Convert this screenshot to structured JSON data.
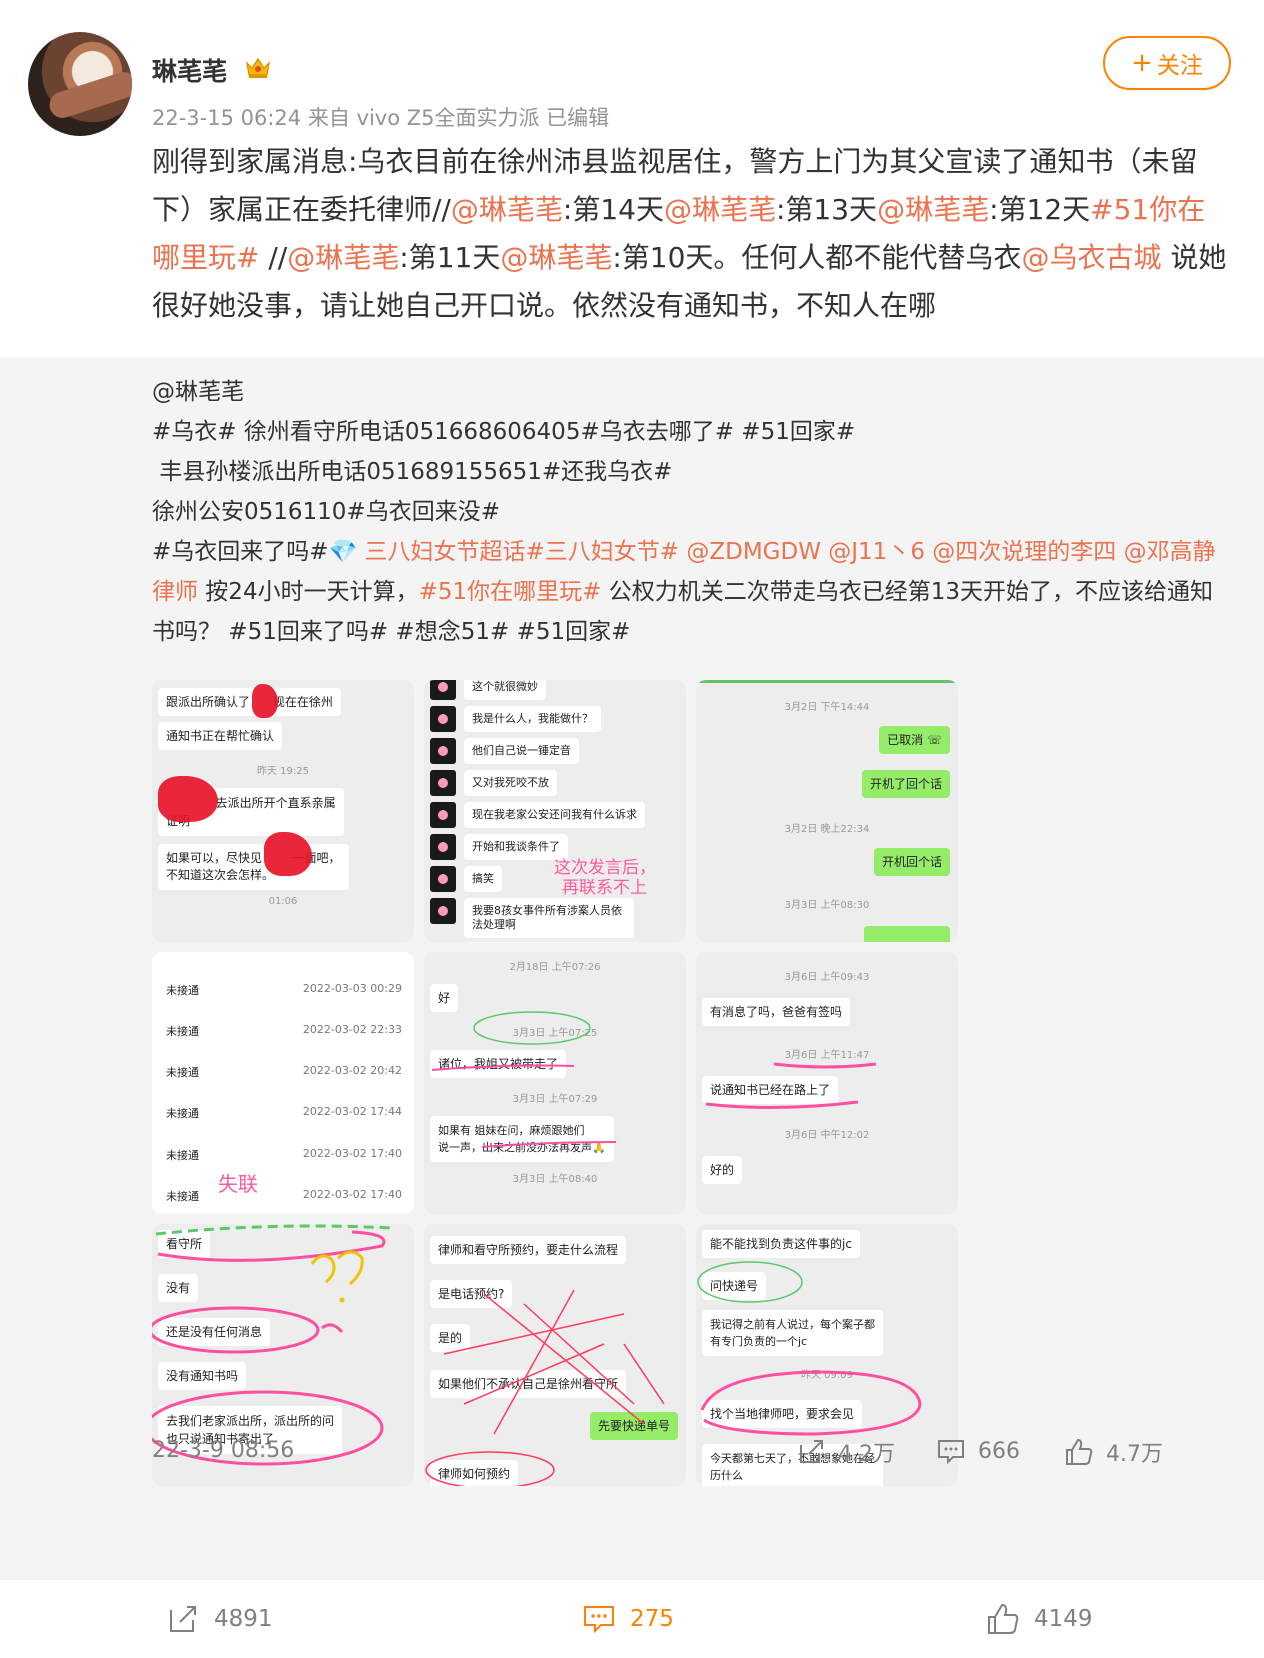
{
  "header": {
    "username": "琳芼芼",
    "time": "22-3-15 06:24",
    "source": "来自 vivo Z5全面实力派",
    "edited": "已编辑",
    "follow_label": "关注"
  },
  "post": {
    "segments": [
      {
        "text": "刚得到家属消息:乌衣目前在徐州沛县监视居住，警方上门为其父宣读了通知书（未留下）家属正在委托律师//",
        "link": false
      },
      {
        "text": "@琳芼芼",
        "link": true
      },
      {
        "text": ":第14天",
        "link": false
      },
      {
        "text": "@琳芼芼",
        "link": true
      },
      {
        "text": ":第13天",
        "link": false
      },
      {
        "text": "@琳芼芼",
        "link": true
      },
      {
        "text": ":第12天",
        "link": false
      },
      {
        "text": "#51你在哪里玩#",
        "link": true
      },
      {
        "text": " //",
        "link": false
      },
      {
        "text": "@琳芼芼",
        "link": true
      },
      {
        "text": ":第11天",
        "link": false
      },
      {
        "text": "@琳芼芼",
        "link": true
      },
      {
        "text": ":第10天。任何人都不能代替乌衣",
        "link": false
      },
      {
        "text": "@乌衣古城",
        "link": true
      },
      {
        "text": " 说她很好她没事，请让她自己开口说。依然没有通知书，不知人在哪",
        "link": false
      }
    ]
  },
  "repost": {
    "author": "@琳芼芼",
    "line1": "#乌衣# 徐州看守所电话051668606405#乌衣去哪了# #51回家#",
    "line2": " 丰县孙楼派出所电话051689155651#还我乌衣#",
    "line3": "徐州公安0516110#乌衣回来没#",
    "line4_segments": [
      {
        "text": "#乌衣回来了吗#",
        "link": false
      },
      {
        "text": "💎 三八妇女节超话",
        "link": true
      },
      {
        "text": "#三八妇女节#",
        "link": true
      },
      {
        "text": " ",
        "link": false
      },
      {
        "text": "@ZDMGDW",
        "link": true
      },
      {
        "text": " ",
        "link": false
      },
      {
        "text": "@J11丶6",
        "link": true
      },
      {
        "text": " ",
        "link": false
      },
      {
        "text": "@四次说理的李四",
        "link": true
      },
      {
        "text": " ",
        "link": false
      },
      {
        "text": "@邓高静律师",
        "link": true
      },
      {
        "text": " 按24小时一天计算，",
        "link": false
      },
      {
        "text": "#51你在哪里玩#",
        "link": true
      },
      {
        "text": " 公权力机关二次带走乌衣已经第13天开始了，不应该给通知书吗？ #51回来了吗# #想念51# #51回家#",
        "link": false
      }
    ],
    "time": "22-3-9 08:56",
    "reposts": "4.2万",
    "comments": "666",
    "likes": "4.7万"
  },
  "images": {
    "img1": {
      "msg1": "跟派出所确认了",
      "msg1b": "现在在徐州",
      "msg2": "通知书正在帮忙确认",
      "ts1": "昨天 19:25",
      "msg3": "去派出所开个直系亲属",
      "msg3b": "证明",
      "msg4a": "如果可以，尽快见",
      "msg4b": "一面吧，",
      "msg4c": "不知道这次会怎样。",
      "ts2": "01:06"
    },
    "img2": {
      "msgs": [
        "这个就很微妙",
        "我是什么人，我能做什？",
        "他们自己说一锤定音",
        "又对我死咬不放",
        "现在我老家公安还问我有什么诉求",
        "开始和我谈条件了",
        "搞笑",
        "我要8孩女事件所有涉案人员依法处理啊"
      ],
      "note1": "这次发言后，",
      "note2": "再联系不上"
    },
    "img3": {
      "ts1": "3月2日 下午14:44",
      "msg1": "已取消",
      "msg2": "开机了回个话",
      "ts2": "3月2日 晚上22:34",
      "msg3": "开机回个话",
      "ts3": "3月3日 上午08:30"
    },
    "img4": {
      "rows": [
        {
          "status": "未接通",
          "time": "2022-03-03 00:29"
        },
        {
          "status": "未接通",
          "time": "2022-03-02 22:33"
        },
        {
          "status": "未接通",
          "time": "2022-03-02 20:42"
        },
        {
          "status": "未接通",
          "time": "2022-03-02 17:44"
        },
        {
          "status": "未接通",
          "time": "2022-03-02 17:40"
        },
        {
          "status": "未接通",
          "time": "2022-03-02 17:40"
        }
      ],
      "note": "失联"
    },
    "img5": {
      "ts1": "2月18日 上午07:26",
      "msg1": "好",
      "ts2": "3月3日 上午07:25",
      "msg2": "诸位，我姐又被带走了",
      "ts3": "3月3日 上午07:29",
      "msg3a": "如果有      姐妹在问，麻烦跟她们",
      "msg3b": "说一声，出来之前没办法再发声🙏",
      "ts4": "3月3日 上午08:40"
    },
    "img6": {
      "ts1": "3月6日 上午09:43",
      "msg1": "有消息了吗，爸爸有签吗",
      "ts2": "3月6日 上午11:47",
      "msg2": "说通知书已经在路上了",
      "ts3": "3月6日 中午12:02",
      "msg3": "好的"
    },
    "img7": {
      "msgs": [
        "看守所",
        "没有",
        "还是没有任何消息",
        "没有通知书吗"
      ],
      "msg5a": "去我们老家派出所，派出所的问",
      "msg5b": "也只说通知书寄出了"
    },
    "img8": {
      "msg1": "律师和看守所预约，要走什么流程",
      "msg2": "是电话预约?",
      "msg3": "是的",
      "msg4": "如果他们不承认自己是徐州看守所",
      "msg5": "先要快递单号",
      "msg6": "律师如何预约"
    },
    "img9": {
      "msg1": "能不能找到负责这件事的jc",
      "msg2": "问快递号",
      "msg3a": "我记得之前有人说过，每个案子都",
      "msg3b": "有专门负责的一个jc",
      "ts1": "昨天 09:09",
      "msg4": "找个当地律师吧，要求会见",
      "msg5a": "今天都第七天了，不敢想象她在经",
      "msg5b": "历什么"
    }
  },
  "toolbar": {
    "repost": "4891",
    "comment": "275",
    "like": "4149"
  },
  "colors": {
    "link": "#eb7350",
    "accent": "#ff8200",
    "annotation_pink": "#ff4fa0"
  }
}
